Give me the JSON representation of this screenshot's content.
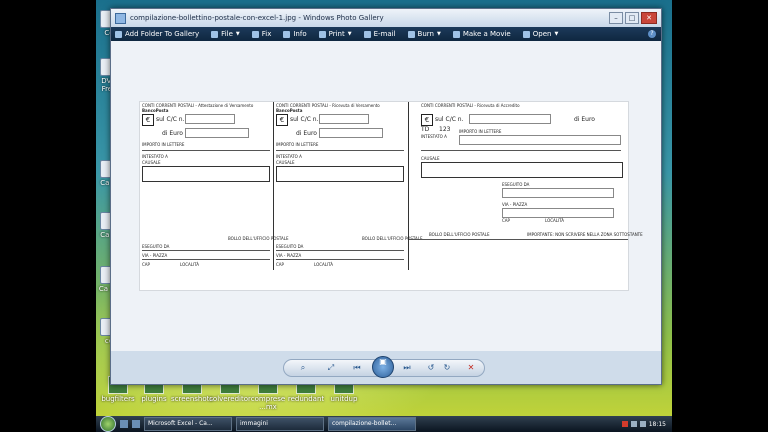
{
  "window": {
    "title": "compilazione-bollettino-postale-con-excel-1.jpg - Windows Photo Gallery",
    "minimize": "–",
    "maximize": "□",
    "close": "✕"
  },
  "toolbar": {
    "items": [
      {
        "label": "Add Folder To Gallery",
        "icon": "folder-add-icon"
      },
      {
        "label": "File",
        "icon": "file-icon"
      },
      {
        "label": "Fix",
        "icon": "fix-icon"
      },
      {
        "label": "Info",
        "icon": "info-icon"
      },
      {
        "label": "Print",
        "icon": "print-icon"
      },
      {
        "label": "E-mail",
        "icon": "email-icon"
      },
      {
        "label": "Burn",
        "icon": "burn-icon"
      },
      {
        "label": "Make a Movie",
        "icon": "movie-icon"
      },
      {
        "label": "Open",
        "icon": "open-icon"
      }
    ],
    "help": "?"
  },
  "document": {
    "slip1": {
      "header": "CONTI CORRENTI POSTALI - Attestazione di Versamento",
      "brand": "BancoPosta",
      "sul_cc": "sul C/C n.",
      "di_euro": "di Euro",
      "importo": "IMPORTO IN LETTERE",
      "intestato": "INTESTATO A",
      "causale": "CAUSALE",
      "bollo": "BOLLO DELL'UFFICIO POSTALE",
      "eseguito": "ESEGUITO DA",
      "via": "VIA - PIAZZA",
      "cap": "CAP",
      "localita": "LOCALITÀ"
    },
    "slip2": {
      "header": "CONTI CORRENTI POSTALI - Ricevuta di Versamento",
      "brand": "BancoPosta",
      "sul_cc": "sul C/C n.",
      "di_euro": "di Euro",
      "importo": "IMPORTO IN LETTERE",
      "intestato": "INTESTATO A",
      "causale": "CAUSALE",
      "bollo": "BOLLO DELL'UFFICIO POSTALE",
      "eseguito": "ESEGUITO DA",
      "via": "VIA - PIAZZA",
      "cap": "CAP",
      "localita": "LOCALITÀ"
    },
    "slip3": {
      "header": "CONTI CORRENTI POSTALI - Ricevuta di Accredito",
      "sul_cc": "sul C/C n.",
      "di_euro": "di Euro",
      "td": "TD",
      "td_num": "123",
      "importo": "IMPORTO IN LETTERE",
      "intestato": "INTESTATO A",
      "causale": "CAUSALE",
      "eseguito": "ESEGUITO DA",
      "via": "VIA - PIAZZA",
      "cap": "CAP",
      "localita": "LOCALITÀ",
      "bollo": "BOLLO DELL'UFFICIO POSTALE",
      "note": "IMPORTANTE: NON SCRIVERE NELLA ZONA SOTTOSTANTE"
    }
  },
  "controls": {
    "zoom": "⌕",
    "fit": "⤢",
    "prev": "⏮",
    "play": "▣",
    "next": "⏭",
    "rotate_ccw": "↺",
    "rotate_cw": "↻",
    "delete": "✕"
  },
  "desktop": {
    "left_icons": [
      "Co",
      "DVD Free",
      "Ca Pi",
      "Ca Pi",
      "Ca Re",
      "ce"
    ],
    "bottom_icons": [
      "bugfilters",
      "plugins",
      "screenshots",
      "colvereditor",
      "comprese ...mx",
      "redundant",
      "unitdup"
    ]
  },
  "taskbar": {
    "tasks": [
      {
        "label": "Microsoft Excel - Ca...",
        "active": false
      },
      {
        "label": "immagini",
        "active": false
      },
      {
        "label": "compilazione-bollet...",
        "active": true
      }
    ],
    "clock": "18:15"
  }
}
